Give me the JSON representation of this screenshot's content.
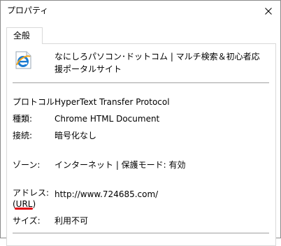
{
  "window": {
    "title": "プロパティ"
  },
  "tabs": [
    {
      "label": "全般"
    }
  ],
  "page": {
    "name": "なにしろパソコン･ドットコム | マルチ検索＆初心者応援ポータルサイト",
    "icon": "internet-explorer-page-icon"
  },
  "properties": {
    "protocol_label": "プロトコル:",
    "protocol_value": "HyperText Transfer Protocol",
    "type_label": "種類:",
    "type_value": "Chrome HTML Document",
    "connection_label": "接続:",
    "connection_value": "暗号化なし",
    "zone_label": "ゾーン:",
    "zone_value": "インターネット | 保護モード: 有効",
    "address_label_line1": "アドレス:",
    "address_label_line2": "(URL)",
    "address_value": "http://www.724685.com/",
    "size_label": "サイズ:",
    "size_value": "利用不可"
  },
  "colors": {
    "annotation_underline": "#e3000f",
    "divider": "#a0a0a0",
    "ie_blue": "#1a7bd2",
    "ie_orange": "#f1a51d"
  }
}
